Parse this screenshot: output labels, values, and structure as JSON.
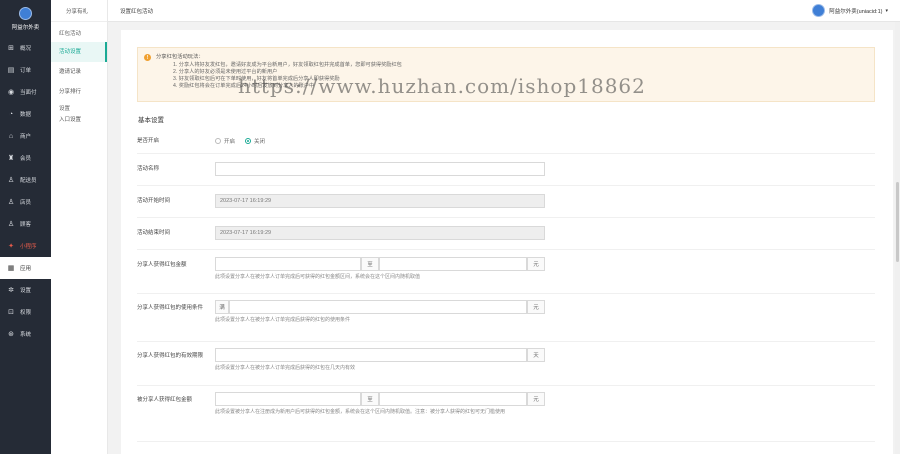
{
  "sidebar": {
    "brand": "阿益尔外卖",
    "items": [
      {
        "label": "概况",
        "icon": "dashboard-icon"
      },
      {
        "label": "订单",
        "icon": "order-icon"
      },
      {
        "label": "当面付",
        "icon": "pay-icon"
      },
      {
        "label": "数据",
        "icon": "chart-icon"
      },
      {
        "label": "商户",
        "icon": "store-icon"
      },
      {
        "label": "会员",
        "icon": "member-icon"
      },
      {
        "label": "配送员",
        "icon": "courier-icon"
      },
      {
        "label": "店员",
        "icon": "clerk-icon"
      },
      {
        "label": "顾客",
        "icon": "customer-icon"
      },
      {
        "label": "小程序",
        "icon": "miniapp-icon"
      },
      {
        "label": "应用",
        "icon": "apps-icon"
      },
      {
        "label": "设置",
        "icon": "settings-icon"
      },
      {
        "label": "权限",
        "icon": "lock-icon"
      },
      {
        "label": "系统",
        "icon": "system-icon"
      }
    ]
  },
  "subnav": {
    "head": "分享有礼",
    "group": "红包活动",
    "items": [
      "活动设置",
      "邀请记录",
      "分享排行"
    ],
    "group2": "设置",
    "items2": [
      "入口设置"
    ]
  },
  "topbar": {
    "title": "设置红包活动",
    "user": "阿益尔外卖(uniacid:1)",
    "caret": "▾"
  },
  "notice": {
    "title": "分享红包活动玩法：",
    "lines": [
      "1. 分享人将好友发红包，邀请好友成为平台新用户，好友领取红包并完成首单，您即可获得奖励红包",
      "2. 分享人的好友必须是未使用过平台的新用户",
      "3. 好友领取红包后可在下单时使用，好友将首单完成后分享人即获得奖励",
      "4. 奖励红包将会在订单完成后24小时后发放到分享人的账户中"
    ]
  },
  "watermark": "https://www.huzhan.com/ishop18862",
  "form": {
    "section": "基本设置",
    "is_open": {
      "label": "是否开启",
      "on": "开启",
      "off": "关闭"
    },
    "name": {
      "label": "活动名称",
      "value": ""
    },
    "start": {
      "label": "活动开始时间",
      "value": "2023-07-17 16:19:29"
    },
    "end": {
      "label": "活动结束时间",
      "value": "2023-07-17 16:19:29"
    },
    "share_amount": {
      "label": "分享人获得红包金额",
      "to": "至",
      "unit": "元",
      "help": "此项设置分享人在被分享人订单完成后可获得的红包金额区间，系统会在这个区间内随机取值"
    },
    "share_condition": {
      "label": "分享人获得红包的使用条件",
      "prefix": "满",
      "unit": "元",
      "help": "此项设置分享人在被分享人订单完成后获得的红包的使用条件"
    },
    "share_valid": {
      "label": "分享人获得红包的有效期限",
      "unit": "天",
      "help": "此项设置分享人在被分享人订单完成后获得的红包在几天内有效"
    },
    "invitee_amount": {
      "label": "被分享人获得红包金额",
      "to": "至",
      "unit": "元",
      "help": "此项设置被分享人在注册成为新用户后可获得的红包金额，系统会在这个区间内随机取值。注意：被分享人获得的红包可无门槛使用"
    }
  },
  "colors": {
    "accent": "#1aaa95",
    "sidebar": "#252b36",
    "notice_bg": "#fdf5e9"
  }
}
